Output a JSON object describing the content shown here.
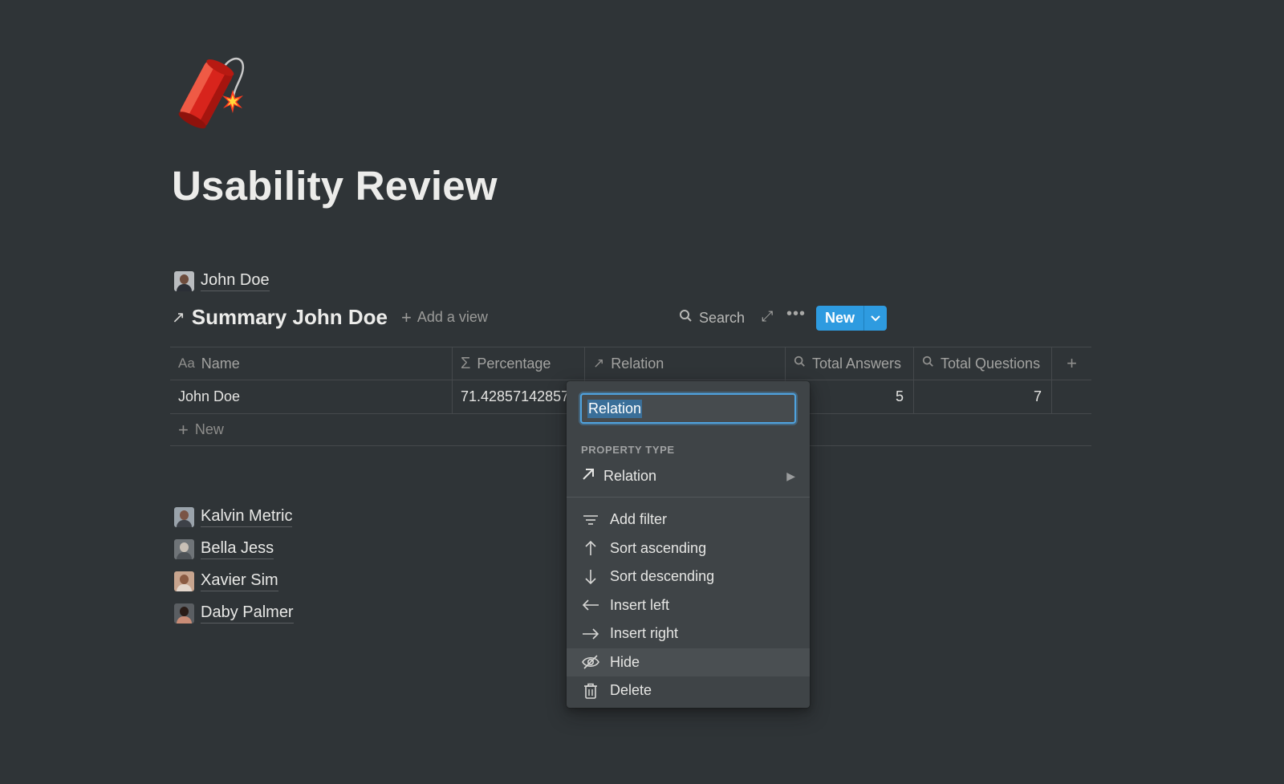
{
  "page": {
    "icon": "firecracker-icon",
    "title": "Usability Review"
  },
  "owner_link": {
    "name": "John Doe"
  },
  "database": {
    "title": "Summary John Doe",
    "add_view_label": "Add a view",
    "search_label": "Search",
    "new_button_label": "New",
    "columns": [
      {
        "icon": "Aa",
        "label": "Name"
      },
      {
        "icon": "Σ",
        "label": "Percentage"
      },
      {
        "icon": "↗",
        "label": "Relation"
      },
      {
        "icon": "search-icon",
        "label": "Total Answers"
      },
      {
        "icon": "search-icon",
        "label": "Total Questions"
      }
    ],
    "rows": [
      {
        "name": "John Doe",
        "percentage": "71.42857142857",
        "relation": "",
        "total_answers": "5",
        "total_questions": "7"
      }
    ],
    "new_row_label": "New"
  },
  "people": [
    {
      "name": "Kalvin Metric"
    },
    {
      "name": "Bella Jess"
    },
    {
      "name": "Xavier Sim"
    },
    {
      "name": "Daby Palmer"
    }
  ],
  "property_menu": {
    "name_value": "Relation",
    "section_label": "PROPERTY TYPE",
    "type_label": "Relation",
    "items": [
      {
        "icon": "filter-icon",
        "label": "Add filter"
      },
      {
        "icon": "arrow-up-icon",
        "label": "Sort ascending"
      },
      {
        "icon": "arrow-down-icon",
        "label": "Sort descending"
      },
      {
        "icon": "arrow-left-icon",
        "label": "Insert left"
      },
      {
        "icon": "arrow-right-icon",
        "label": "Insert right"
      },
      {
        "icon": "eye-off-icon",
        "label": "Hide"
      },
      {
        "icon": "trash-icon",
        "label": "Delete"
      }
    ]
  },
  "colors": {
    "background": "#2f3437",
    "accent": "#2e9be0",
    "menu_background": "#3f4447"
  }
}
